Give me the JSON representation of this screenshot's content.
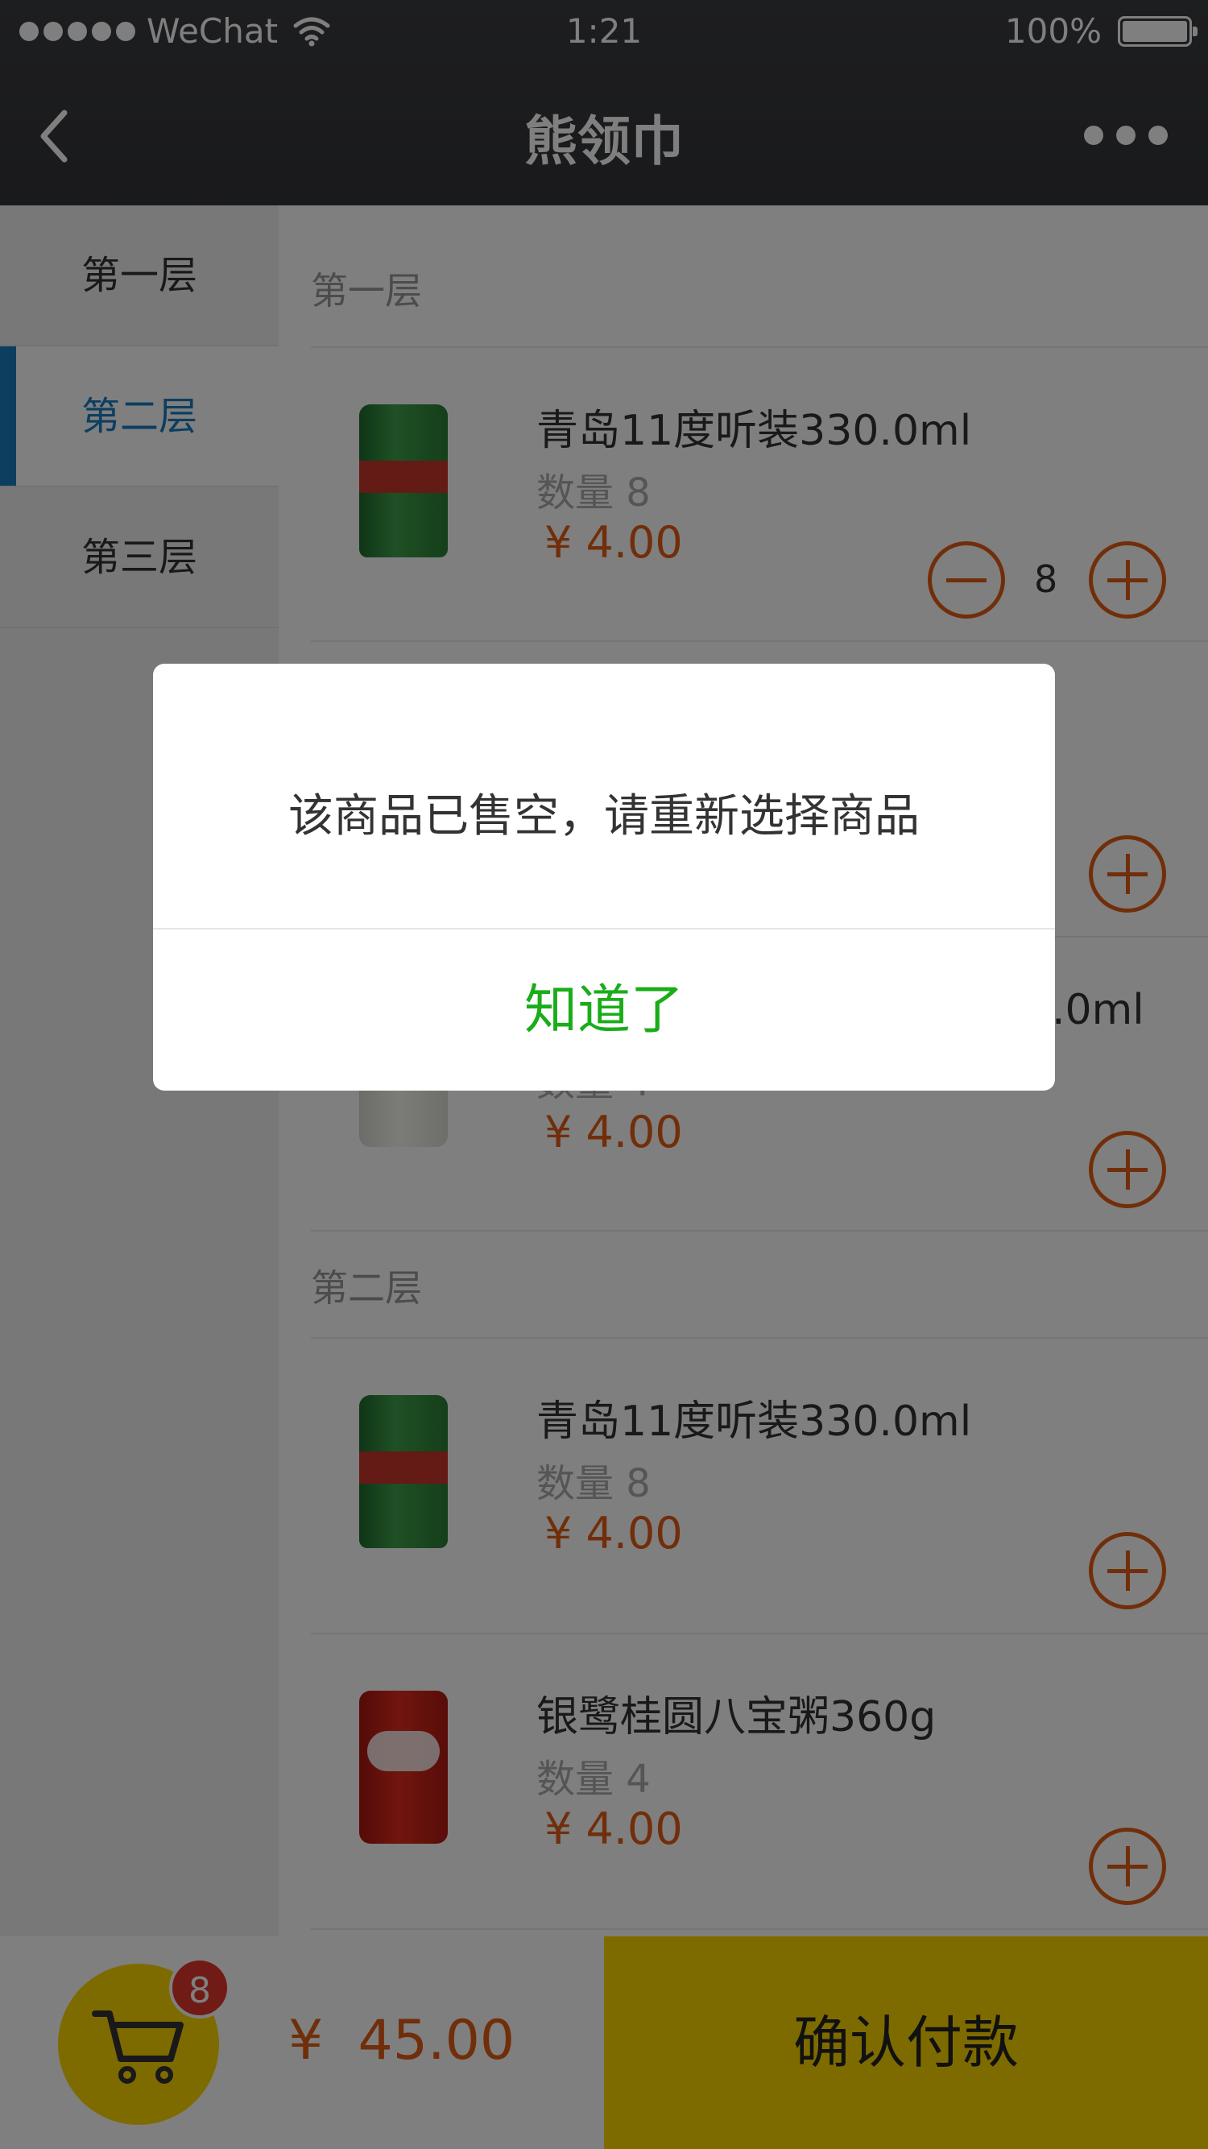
{
  "status_bar": {
    "carrier": "WeChat",
    "time": "1:21",
    "battery": "100%"
  },
  "nav": {
    "title": "熊领巾"
  },
  "sidebar": {
    "items": [
      {
        "label": "第一层",
        "active": false
      },
      {
        "label": "第二层",
        "active": true
      },
      {
        "label": "第三层",
        "active": false
      }
    ]
  },
  "sections": [
    {
      "header": "第一层",
      "products": [
        {
          "name": "青岛11度听装330.0ml",
          "qty_label": "数量 8",
          "price": "¥ 4.00",
          "in_cart": "8",
          "image": "tsingtao-can"
        },
        {
          "name": "",
          "qty_label": "",
          "price": "",
          "image": ""
        },
        {
          "name": ".0ml",
          "qty_label": "数量 4",
          "price": "¥ 4.00",
          "image": "youyi-bottle"
        }
      ]
    },
    {
      "header": "第二层",
      "products": [
        {
          "name": "青岛11度听装330.0ml",
          "qty_label": "数量 8",
          "price": "¥ 4.00",
          "image": "tsingtao-can"
        },
        {
          "name": "银鹭桂圆八宝粥360g",
          "qty_label": "数量 4",
          "price": "¥ 4.00",
          "image": "yinlu-can"
        }
      ]
    }
  ],
  "cart": {
    "badge": "8",
    "total": "¥  45.00",
    "confirm_label": "确认付款"
  },
  "modal": {
    "message": "该商品已售空，请重新选择商品",
    "ok_label": "知道了"
  },
  "colors": {
    "accent": "#e35c14",
    "active_tab": "#1a7dc1",
    "ok_green": "#1aad19",
    "cart_yellow": "#fcd700"
  }
}
